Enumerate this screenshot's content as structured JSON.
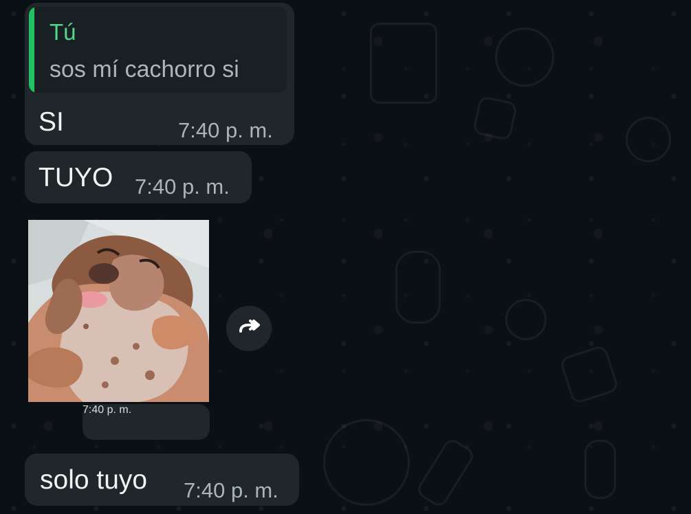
{
  "messages": [
    {
      "quoted": {
        "author": "Tú",
        "text": "sos mí cachorro si"
      },
      "text": "SI",
      "time": "7:40 p. m."
    },
    {
      "text": "TUYO",
      "time": "7:40 p. m."
    },
    {
      "sticker": "dachshund-sticker",
      "time": "7:40 p. m."
    },
    {
      "text": "solo tuyo",
      "time": "7:40 p. m."
    }
  ],
  "icons": {
    "forward": "forward-icon"
  },
  "colors": {
    "background": "#0b1014",
    "bubble": "#1f272b",
    "quote_bar": "#21c063",
    "quote_author": "#53d889",
    "time": "#aab4ba"
  }
}
